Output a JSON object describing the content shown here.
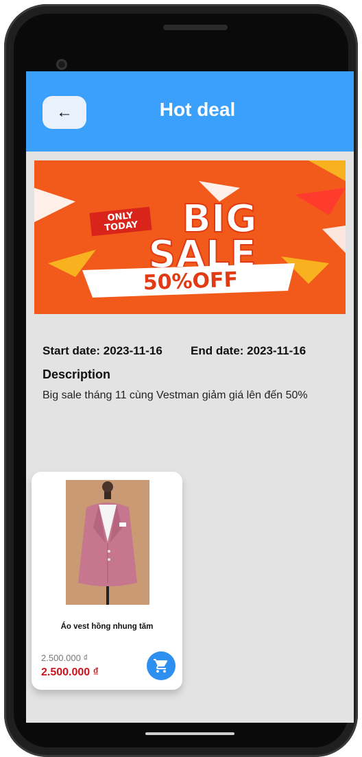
{
  "header": {
    "title": "Hot deal",
    "back_icon": "arrow-left-icon"
  },
  "banner": {
    "line1": "ONLY",
    "line2": "TODAY",
    "big": "BIG",
    "sale": "SALE",
    "off": "50%OFF"
  },
  "deal": {
    "start_date": "Start date: 2023-11-16",
    "end_date": "End date: 2023-11-16",
    "description_label": "Description",
    "description": "Big sale tháng 11 cùng Vestman giảm giá lên đến 50%"
  },
  "products": [
    {
      "name": "Áo vest hồng nhung tăm",
      "old_price": "2.500.000 ₫",
      "price": "2.500.000 ₫",
      "cart_icon": "shopping-cart-icon"
    }
  ],
  "colors": {
    "appbar": "#3aa0fb",
    "price": "#d0131b",
    "cart_button": "#2d8ff0",
    "screen_bg": "#e3e3e3"
  }
}
